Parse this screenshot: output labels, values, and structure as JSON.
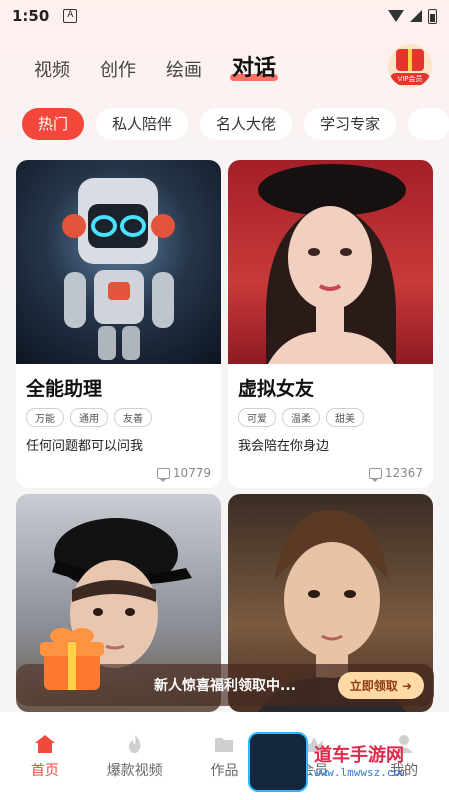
{
  "status_bar": {
    "time": "1:50"
  },
  "top_tabs": [
    {
      "label": "视频"
    },
    {
      "label": "创作"
    },
    {
      "label": "绘画"
    },
    {
      "label": "对话"
    }
  ],
  "vip": {
    "label": "VIP会员"
  },
  "chips": [
    {
      "label": "热门"
    },
    {
      "label": "私人陪伴"
    },
    {
      "label": "名人大佬"
    },
    {
      "label": "学习专家"
    }
  ],
  "cards": [
    {
      "name": "全能助理",
      "tags": [
        "万能",
        "通用",
        "友善"
      ],
      "desc": "任何问题都可以问我",
      "count": "10779"
    },
    {
      "name": "虚拟女友",
      "tags": [
        "可爱",
        "温柔",
        "甜美"
      ],
      "desc": "我会陪在你身边",
      "count": "12367"
    }
  ],
  "promo": {
    "text": "新人惊喜福利领取中...",
    "button": "立即领取 ➜"
  },
  "bottom_nav": [
    {
      "label": "首页"
    },
    {
      "label": "爆款视频"
    },
    {
      "label": "作品"
    },
    {
      "label": "会员"
    },
    {
      "label": "我的"
    }
  ],
  "watermark": {
    "text": "道车手游网",
    "url": "www.lmwwsz.com"
  },
  "colors": {
    "accent": "#f4473b",
    "promo_button": "#ffd9a6"
  }
}
